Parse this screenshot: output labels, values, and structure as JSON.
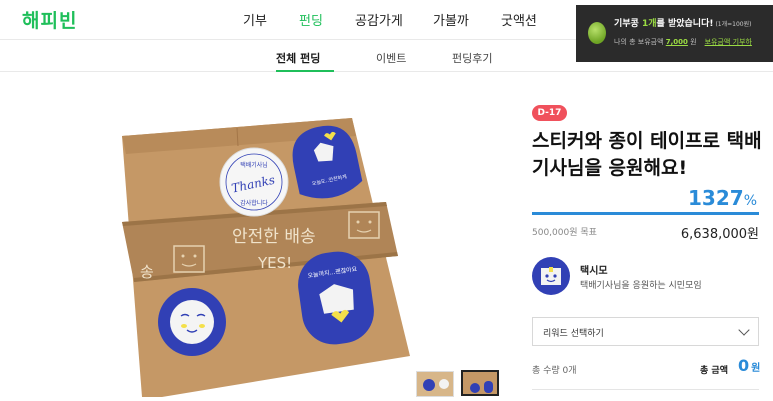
{
  "header": {
    "logo": "해피빈",
    "nav": [
      "기부",
      "펀딩",
      "공감가게",
      "가볼까",
      "굿액션"
    ]
  },
  "subnav": [
    "전체 펀딩",
    "이벤트",
    "펀딩후기"
  ],
  "popup": {
    "title_pre": "기부콩 ",
    "title_hl": "1개",
    "title_post": "를 받았습니다!",
    "title_small": "(1개=100원)",
    "line_pre": "나의 총 보유금액 ",
    "amount": "7,000",
    "line_unit": " 원",
    "link": "보유금액 기부하"
  },
  "product_image": {
    "tape_text_1": "안전한 배송",
    "tape_text_2": "YES!",
    "tape_left": "송",
    "sticker_thanks_1": "Thanks",
    "sticker_thanks_2": "택배기사님",
    "sticker_thanks_3": "감사합니다",
    "sticker_box_text": "오늘도..안전하게",
    "sticker_bottom_right": "오늘까지...괜찮아요"
  },
  "campaign": {
    "dday": "D-17",
    "title": "스티커와 종이 테이프로 택배기사님을 응원해요!",
    "percent": "1327",
    "percent_value": 1327,
    "percent_unit": "%",
    "goal": "500,000원 목표",
    "raised": "6,638,000원"
  },
  "organizer": {
    "name": "택시모",
    "desc": "택배기사님을 응원하는 시민모임"
  },
  "reward": {
    "select_label": "리워드 선택하기"
  },
  "summary": {
    "qty": "총 수량  0개",
    "total_label": "총 금액",
    "total_value": "0",
    "total_unit": "원"
  },
  "colors": {
    "brand_green": "#1fbf5a",
    "accent_blue": "#2a8bd8",
    "dday_red": "#f0515c",
    "sticker_navy": "#3140b5"
  }
}
